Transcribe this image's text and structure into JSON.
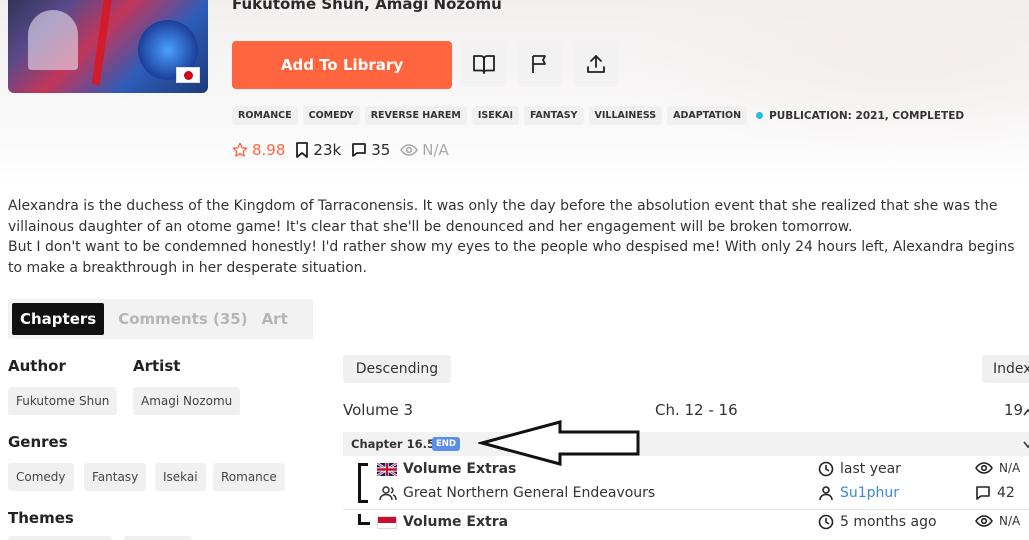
{
  "manga": {
    "authors_line": "Fukutome Shun, Amagi Nozomu",
    "cover_flag": "jp-flag"
  },
  "actions": {
    "add_to_library": "Add To Library",
    "icons": [
      "book-open-icon",
      "flag-icon",
      "share-upload-icon"
    ]
  },
  "tags": [
    "ROMANCE",
    "COMEDY",
    "REVERSE HAREM",
    "ISEKAI",
    "FANTASY",
    "VILLAINESS",
    "ADAPTATION"
  ],
  "publication": "PUBLICATION: 2021, COMPLETED",
  "stats": {
    "rating": "8.98",
    "follows": "23k",
    "comments": "35",
    "views": "N/A"
  },
  "description": [
    "Alexandra is the duchess of the Kingdom of Tarraconensis. It was only the day before the absolution event that she realized that she was the villainous daughter of an otome game! It's clear that she'll be denounced and her engagement will be broken tomorrow.",
    "But I don't want to be condemned honestly! I'd rather show my eyes to the people who despised me! With only 24 hours left, Alexandra begins to make a breakthrough in her desperate situation."
  ],
  "tabs": {
    "chapters": "Chapters",
    "comments": "Comments (35)",
    "art": "Art"
  },
  "sidebar": {
    "author_heading": "Author",
    "author": "Fukutome Shun",
    "artist_heading": "Artist",
    "artist": "Amagi Nozomu",
    "genres_heading": "Genres",
    "genres": [
      "Comedy",
      "Fantasy",
      "Isekai",
      "Romance"
    ],
    "themes_heading": "Themes"
  },
  "chapters": {
    "sort": "Descending",
    "index": "Index",
    "volume": {
      "label": "Volume 3",
      "range": "Ch. 12 - 16",
      "count": "19"
    },
    "chapter": {
      "title": "Chapter 16.5",
      "badge": "END"
    },
    "releases": [
      {
        "flag": "uk-flag",
        "title": "Volume Extras",
        "time": "last year",
        "views": "N/A",
        "group": "Great Northern General Endeavours",
        "uploader": "Su1phur",
        "comments": "42"
      },
      {
        "flag": "id-flag",
        "title": "Volume Extra",
        "time": "5 months ago",
        "views": "N/A"
      }
    ]
  },
  "colors": {
    "accent": "#ff6640",
    "badge_blue": "#5a8ee8",
    "status_dot": "#2fb5e6",
    "link_blue": "#3a8ad6"
  }
}
